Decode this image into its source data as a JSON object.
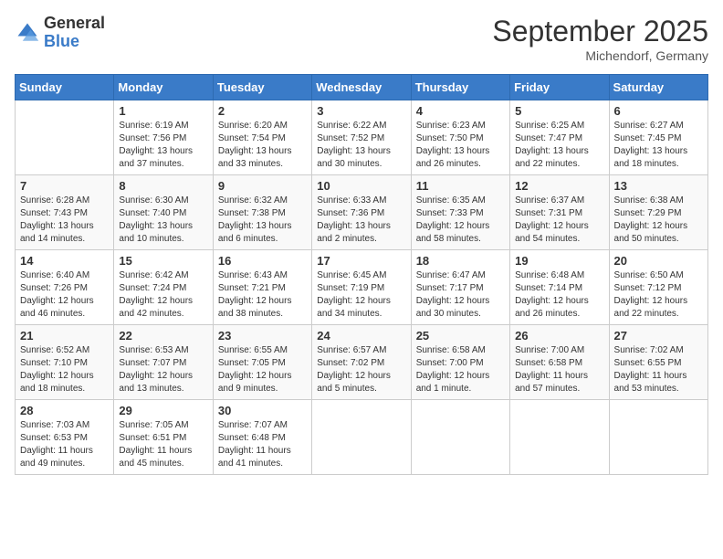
{
  "logo": {
    "general": "General",
    "blue": "Blue"
  },
  "title": "September 2025",
  "location": "Michendorf, Germany",
  "weekdays": [
    "Sunday",
    "Monday",
    "Tuesday",
    "Wednesday",
    "Thursday",
    "Friday",
    "Saturday"
  ],
  "weeks": [
    [
      {
        "day": "",
        "sunrise": "",
        "sunset": "",
        "daylight": ""
      },
      {
        "day": "1",
        "sunrise": "Sunrise: 6:19 AM",
        "sunset": "Sunset: 7:56 PM",
        "daylight": "Daylight: 13 hours and 37 minutes."
      },
      {
        "day": "2",
        "sunrise": "Sunrise: 6:20 AM",
        "sunset": "Sunset: 7:54 PM",
        "daylight": "Daylight: 13 hours and 33 minutes."
      },
      {
        "day": "3",
        "sunrise": "Sunrise: 6:22 AM",
        "sunset": "Sunset: 7:52 PM",
        "daylight": "Daylight: 13 hours and 30 minutes."
      },
      {
        "day": "4",
        "sunrise": "Sunrise: 6:23 AM",
        "sunset": "Sunset: 7:50 PM",
        "daylight": "Daylight: 13 hours and 26 minutes."
      },
      {
        "day": "5",
        "sunrise": "Sunrise: 6:25 AM",
        "sunset": "Sunset: 7:47 PM",
        "daylight": "Daylight: 13 hours and 22 minutes."
      },
      {
        "day": "6",
        "sunrise": "Sunrise: 6:27 AM",
        "sunset": "Sunset: 7:45 PM",
        "daylight": "Daylight: 13 hours and 18 minutes."
      }
    ],
    [
      {
        "day": "7",
        "sunrise": "Sunrise: 6:28 AM",
        "sunset": "Sunset: 7:43 PM",
        "daylight": "Daylight: 13 hours and 14 minutes."
      },
      {
        "day": "8",
        "sunrise": "Sunrise: 6:30 AM",
        "sunset": "Sunset: 7:40 PM",
        "daylight": "Daylight: 13 hours and 10 minutes."
      },
      {
        "day": "9",
        "sunrise": "Sunrise: 6:32 AM",
        "sunset": "Sunset: 7:38 PM",
        "daylight": "Daylight: 13 hours and 6 minutes."
      },
      {
        "day": "10",
        "sunrise": "Sunrise: 6:33 AM",
        "sunset": "Sunset: 7:36 PM",
        "daylight": "Daylight: 13 hours and 2 minutes."
      },
      {
        "day": "11",
        "sunrise": "Sunrise: 6:35 AM",
        "sunset": "Sunset: 7:33 PM",
        "daylight": "Daylight: 12 hours and 58 minutes."
      },
      {
        "day": "12",
        "sunrise": "Sunrise: 6:37 AM",
        "sunset": "Sunset: 7:31 PM",
        "daylight": "Daylight: 12 hours and 54 minutes."
      },
      {
        "day": "13",
        "sunrise": "Sunrise: 6:38 AM",
        "sunset": "Sunset: 7:29 PM",
        "daylight": "Daylight: 12 hours and 50 minutes."
      }
    ],
    [
      {
        "day": "14",
        "sunrise": "Sunrise: 6:40 AM",
        "sunset": "Sunset: 7:26 PM",
        "daylight": "Daylight: 12 hours and 46 minutes."
      },
      {
        "day": "15",
        "sunrise": "Sunrise: 6:42 AM",
        "sunset": "Sunset: 7:24 PM",
        "daylight": "Daylight: 12 hours and 42 minutes."
      },
      {
        "day": "16",
        "sunrise": "Sunrise: 6:43 AM",
        "sunset": "Sunset: 7:21 PM",
        "daylight": "Daylight: 12 hours and 38 minutes."
      },
      {
        "day": "17",
        "sunrise": "Sunrise: 6:45 AM",
        "sunset": "Sunset: 7:19 PM",
        "daylight": "Daylight: 12 hours and 34 minutes."
      },
      {
        "day": "18",
        "sunrise": "Sunrise: 6:47 AM",
        "sunset": "Sunset: 7:17 PM",
        "daylight": "Daylight: 12 hours and 30 minutes."
      },
      {
        "day": "19",
        "sunrise": "Sunrise: 6:48 AM",
        "sunset": "Sunset: 7:14 PM",
        "daylight": "Daylight: 12 hours and 26 minutes."
      },
      {
        "day": "20",
        "sunrise": "Sunrise: 6:50 AM",
        "sunset": "Sunset: 7:12 PM",
        "daylight": "Daylight: 12 hours and 22 minutes."
      }
    ],
    [
      {
        "day": "21",
        "sunrise": "Sunrise: 6:52 AM",
        "sunset": "Sunset: 7:10 PM",
        "daylight": "Daylight: 12 hours and 18 minutes."
      },
      {
        "day": "22",
        "sunrise": "Sunrise: 6:53 AM",
        "sunset": "Sunset: 7:07 PM",
        "daylight": "Daylight: 12 hours and 13 minutes."
      },
      {
        "day": "23",
        "sunrise": "Sunrise: 6:55 AM",
        "sunset": "Sunset: 7:05 PM",
        "daylight": "Daylight: 12 hours and 9 minutes."
      },
      {
        "day": "24",
        "sunrise": "Sunrise: 6:57 AM",
        "sunset": "Sunset: 7:02 PM",
        "daylight": "Daylight: 12 hours and 5 minutes."
      },
      {
        "day": "25",
        "sunrise": "Sunrise: 6:58 AM",
        "sunset": "Sunset: 7:00 PM",
        "daylight": "Daylight: 12 hours and 1 minute."
      },
      {
        "day": "26",
        "sunrise": "Sunrise: 7:00 AM",
        "sunset": "Sunset: 6:58 PM",
        "daylight": "Daylight: 11 hours and 57 minutes."
      },
      {
        "day": "27",
        "sunrise": "Sunrise: 7:02 AM",
        "sunset": "Sunset: 6:55 PM",
        "daylight": "Daylight: 11 hours and 53 minutes."
      }
    ],
    [
      {
        "day": "28",
        "sunrise": "Sunrise: 7:03 AM",
        "sunset": "Sunset: 6:53 PM",
        "daylight": "Daylight: 11 hours and 49 minutes."
      },
      {
        "day": "29",
        "sunrise": "Sunrise: 7:05 AM",
        "sunset": "Sunset: 6:51 PM",
        "daylight": "Daylight: 11 hours and 45 minutes."
      },
      {
        "day": "30",
        "sunrise": "Sunrise: 7:07 AM",
        "sunset": "Sunset: 6:48 PM",
        "daylight": "Daylight: 11 hours and 41 minutes."
      },
      {
        "day": "",
        "sunrise": "",
        "sunset": "",
        "daylight": ""
      },
      {
        "day": "",
        "sunrise": "",
        "sunset": "",
        "daylight": ""
      },
      {
        "day": "",
        "sunrise": "",
        "sunset": "",
        "daylight": ""
      },
      {
        "day": "",
        "sunrise": "",
        "sunset": "",
        "daylight": ""
      }
    ]
  ]
}
